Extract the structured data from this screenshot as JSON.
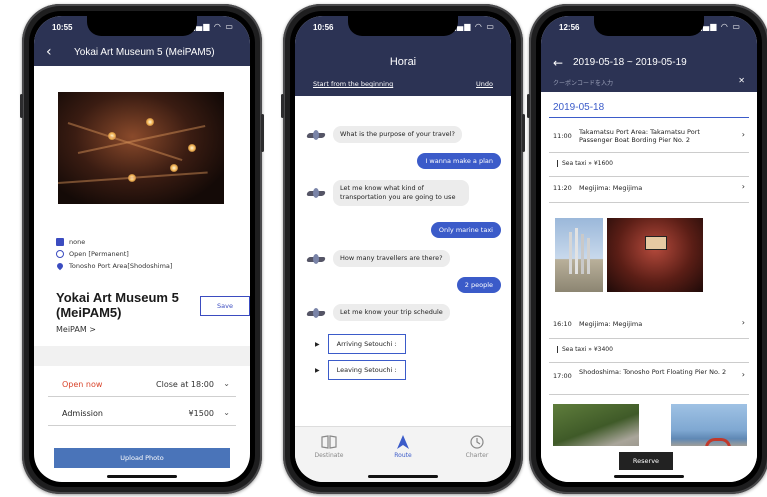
{
  "phone1": {
    "status_time": "10:55",
    "title": "Yokai Art Museum 5 (MeiPAM5)",
    "meta": {
      "category": "none",
      "hours": "Open [Permanent]",
      "access": "Tonosho Port Area[Shodoshima]"
    },
    "name": "Yokai Art Museum 5 (MeiPAM5)",
    "group_link": "MeiPAM >",
    "save_label": "Save",
    "open_status": "Open now",
    "close_time": "Close at 18:00",
    "admission_label": "Admission",
    "admission_price": "¥1500",
    "upload_label": "Upload Photo"
  },
  "phone2": {
    "status_time": "10:56",
    "title": "Horai",
    "start_over": "Start from the beginning",
    "undo": "Undo",
    "messages": {
      "q1": "What is the purpose of your travel?",
      "a1": "I wanna make a plan",
      "q2": "Let me know what kind of transportation you are going to use",
      "a2": "Only marine taxi",
      "q3": "How many travellers are there?",
      "a3": "2 people",
      "q4": "Let me know your trip schedule"
    },
    "options": {
      "arriving": "Arriving Setouchi :",
      "leaving": "Leaving Setouchi :"
    },
    "tabs": {
      "destinate": "Destinate",
      "route": "Route",
      "charter": "Charter"
    },
    "accent": "#3b5bc9"
  },
  "phone3": {
    "status_time": "12:56",
    "title": "2019-05-18 ~ 2019-05-19",
    "coupon_placeholder": "クーポンコードを入力",
    "date": "2019-05-18",
    "items": [
      {
        "time": "11:00",
        "desc": "Takamatsu Port Area: Takamatsu Port Passenger Boat Bording Pier No. 2"
      },
      {
        "time": "11:20",
        "desc": "Megijima: Megijima"
      },
      {
        "time": "16:10",
        "desc": "Megijima: Megijima"
      },
      {
        "time": "17:00",
        "desc": "Shodoshima: Tonosho Port Floating Pier No. 2"
      }
    ],
    "taxi1": "Sea taxi  »  ¥1600",
    "taxi2": "Sea taxi  »  ¥3400",
    "reserve_label": "Reserve"
  },
  "colors": {
    "header": "#2c3354",
    "accent": "#3b5bc9",
    "upload": "#4a74b9",
    "open_now": "#d9442b"
  }
}
